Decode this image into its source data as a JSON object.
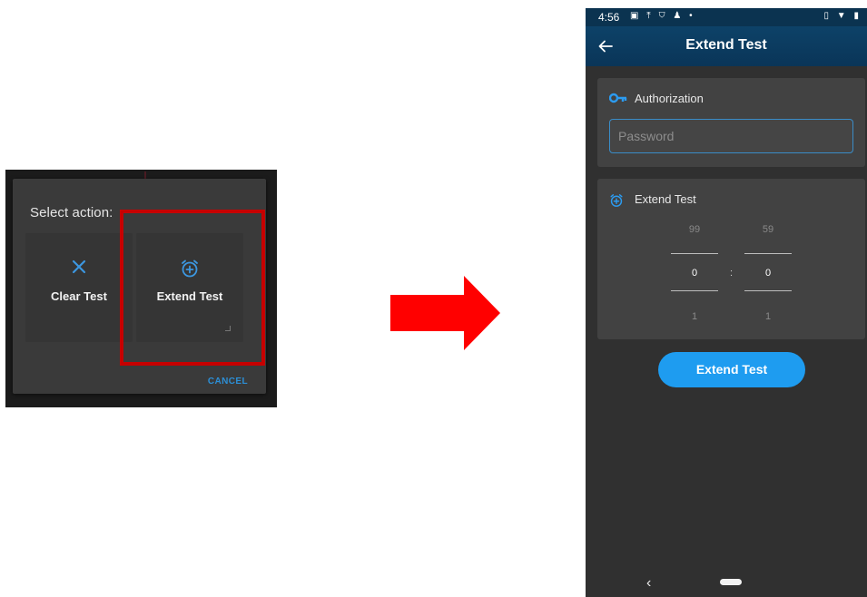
{
  "dialog": {
    "title": "Select action:",
    "clear_label": "Clear Test",
    "extend_label": "Extend Test",
    "cancel_label": "CANCEL",
    "accent_color": "#2c8fd6",
    "highlight_color": "#c60000",
    "clear_icon": "close-icon",
    "extend_icon": "alarm-add-icon"
  },
  "arrow": {
    "color": "#ff0000",
    "icon": "right-arrow-icon"
  },
  "phone": {
    "status_bar": {
      "time": "4:56",
      "left_icons": [
        "image-icon",
        "upload-icon",
        "shield-icon",
        "person-icon",
        "dot-icon"
      ],
      "right_icons": [
        "vibrate-icon",
        "wifi-icon",
        "battery-icon"
      ]
    },
    "app_bar": {
      "title": "Extend Test",
      "back_icon": "back-arrow-icon",
      "color": "#0d4268"
    },
    "authorization": {
      "heading": "Authorization",
      "icon": "key-icon",
      "password_placeholder": "Password",
      "password_value": ""
    },
    "extend_section": {
      "heading": "Extend Test",
      "icon": "alarm-add-icon",
      "hours": {
        "prev": "99",
        "current": "0",
        "next": "1"
      },
      "separator": ":",
      "minutes": {
        "prev": "59",
        "current": "0",
        "next": "1"
      }
    },
    "extend_button": {
      "label": "Extend Test",
      "color": "#1e9cf0"
    },
    "nav_bar": {
      "back_icon": "chevron-left-icon",
      "home_icon": "home-pill-icon"
    }
  }
}
